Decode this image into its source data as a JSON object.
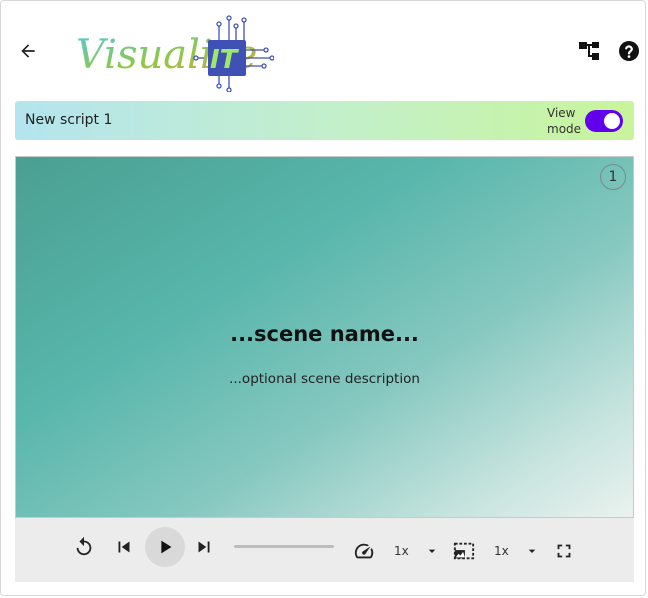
{
  "header": {
    "logo_text": "VisualizeIT",
    "back_icon": "arrow-back-icon",
    "tree_icon": "account-tree-icon",
    "help_icon": "help-icon"
  },
  "script_bar": {
    "title": "New script 1",
    "view_mode_label": "View mode",
    "view_mode_on": true,
    "toggle_color": "#6200ee"
  },
  "stage": {
    "scene_number": "1",
    "scene_name": "...scene name...",
    "scene_description": "...optional scene description"
  },
  "controls": {
    "icons": [
      "replay-icon",
      "skip-previous-icon",
      "play-icon",
      "skip-next-icon",
      "speed-icon",
      "photo-size-select-icon",
      "fullscreen-icon"
    ],
    "speed_value": "1x",
    "scale_value": "1x",
    "progress": 0
  }
}
